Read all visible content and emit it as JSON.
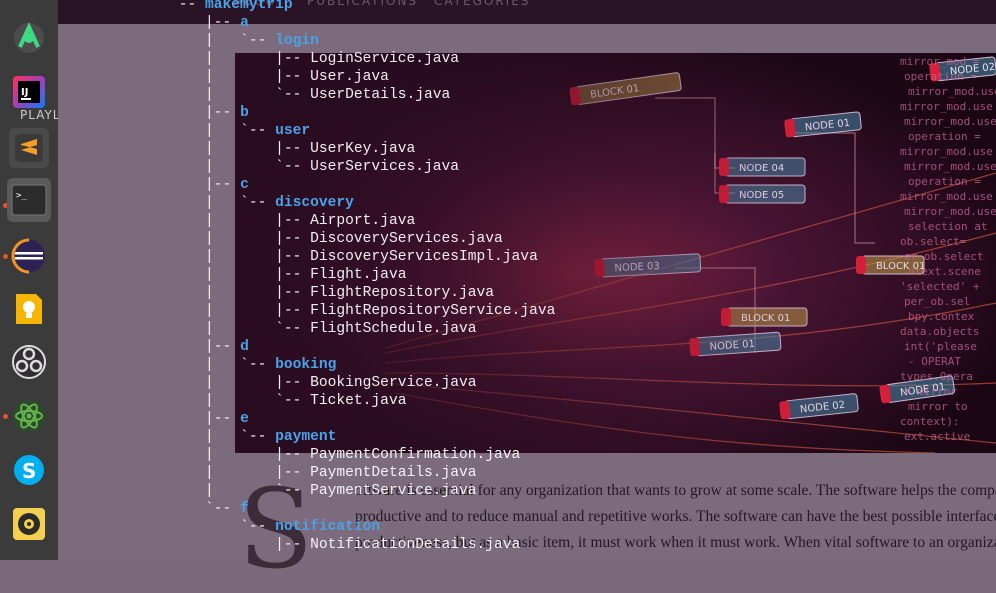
{
  "dock": {
    "label": "PLAYL",
    "items": [
      {
        "name": "android-studio-icon",
        "color": "#3ddc84"
      },
      {
        "name": "intellij-idea-icon",
        "color": "#fe315d"
      },
      {
        "name": "sublime-text-icon",
        "color": "#f59d25"
      },
      {
        "name": "terminal-icon",
        "color": "#2c2c2c"
      },
      {
        "name": "eclipse-icon",
        "color": "#2c2255"
      },
      {
        "name": "google-keep-icon",
        "color": "#f7b500"
      },
      {
        "name": "obs-studio-icon",
        "color": "#302e31"
      },
      {
        "name": "atom-icon",
        "color": "#66b54c"
      },
      {
        "name": "skype-icon",
        "color": "#00aff0"
      },
      {
        "name": "rhythmbox-icon",
        "color": "#f3d04f"
      }
    ]
  },
  "nav": {
    "about": "ABOUT",
    "publications": "PUBLICATIONS",
    "categories": "CATEGORIES"
  },
  "banner": {
    "labels": [
      "BLOCK 01",
      "NODE 01",
      "NODE 04",
      "NODE 05",
      "NODE 03",
      "BLOCK 01",
      "BLOCK 01",
      "NODE 01",
      "NODE 02",
      "NODE 01",
      "NODE 02"
    ],
    "code": [
      "mirror_mod = ",
      "operation = ",
      "mirror_mod.use",
      "mirror_mod.use",
      "mirror_mod.use",
      "operation = ",
      "mirror_mod.use",
      "mirror_mod.use",
      "operation = ",
      "mirror_mod.use",
      "mirror_mod.use",
      "selection at",
      "ob.select=",
      "er_ob.select",
      "ntext.scene",
      "'selected' +",
      "per_ob.sel",
      "bpy.contex",
      "data.objects",
      "int('please",
      "- OPERAT",
      "types.Opera",
      "X mirror",
      "mirror to",
      "context):",
      "ext.active"
    ]
  },
  "tree": [
    {
      "g": "`-- ",
      "d": "makemytrip"
    },
    {
      "g": "    |-- ",
      "d": "a"
    },
    {
      "g": "    |   `-- ",
      "d": "login"
    },
    {
      "g": "    |       |-- LoginService.java"
    },
    {
      "g": "    |       |-- User.java"
    },
    {
      "g": "    |       `-- UserDetails.java"
    },
    {
      "g": "    |-- ",
      "d": "b"
    },
    {
      "g": "    |   `-- ",
      "d": "user"
    },
    {
      "g": "    |       |-- UserKey.java"
    },
    {
      "g": "    |       `-- UserServices.java"
    },
    {
      "g": "    |-- ",
      "d": "c"
    },
    {
      "g": "    |   `-- ",
      "d": "discovery"
    },
    {
      "g": "    |       |-- Airport.java"
    },
    {
      "g": "    |       |-- DiscoveryServices.java"
    },
    {
      "g": "    |       |-- DiscoveryServicesImpl.java"
    },
    {
      "g": "    |       |-- Flight.java"
    },
    {
      "g": "    |       |-- FlightRepository.java"
    },
    {
      "g": "    |       |-- FlightRepositoryService.java"
    },
    {
      "g": "    |       `-- FlightSchedule.java"
    },
    {
      "g": "    |-- ",
      "d": "d"
    },
    {
      "g": "    |   `-- ",
      "d": "booking"
    },
    {
      "g": "    |       |-- BookingService.java"
    },
    {
      "g": "    |       `-- Ticket.java"
    },
    {
      "g": "    |-- ",
      "d": "e"
    },
    {
      "g": "    |   `-- ",
      "d": "payment"
    },
    {
      "g": "    |       |-- PaymentConfirmation.java"
    },
    {
      "g": "    |       |-- PaymentDetails.java"
    },
    {
      "g": "    |       `-- PaymentService.java"
    },
    {
      "g": "    `-- ",
      "d": "f"
    },
    {
      "g": "        `-- ",
      "d": "notification"
    },
    {
      "g": "            |-- NotificationDetails.java"
    }
  ],
  "article": {
    "dropcap": "S",
    "lines": [
      "oftware is essential for any organization that wants to grow at some scale. The software helps the company's e",
      "productive and to reduce manual and repetitive works. The software can have the best possible interface, turn",
      "productiveness, but as a basic item, it must work when it must work. When vital software to an organization"
    ]
  }
}
